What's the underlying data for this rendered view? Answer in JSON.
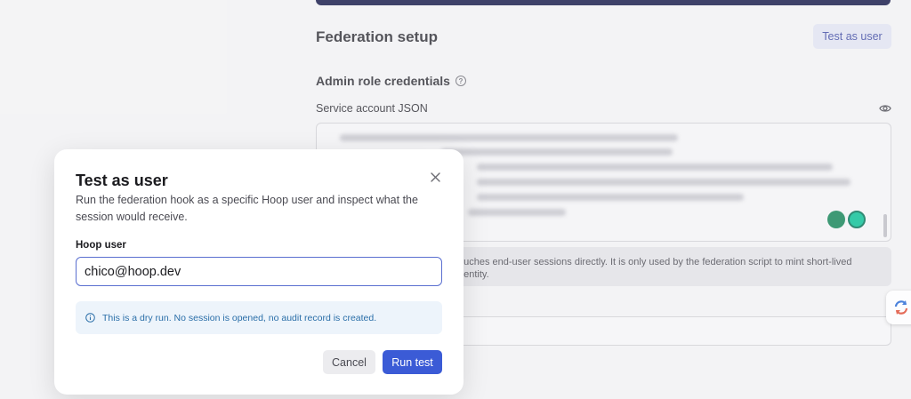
{
  "background": {
    "section_title": "Federation setup",
    "test_as_user_button": "Test as user",
    "admin_title": "Admin role credentials",
    "service_account_label": "Service account JSON",
    "note_text": "ouches end-user sessions directly. It is only used by the federation script to mint short-lived",
    "note_text_2": "dentity."
  },
  "modal": {
    "title": "Test as user",
    "description": "Run the federation hook as a specific Hoop user and inspect what the session would receive.",
    "hoop_user_label": "Hoop user",
    "hoop_user_value": "chico@hoop.dev",
    "info_text": "This is a dry run. No session is opened, no audit record is created.",
    "cancel_label": "Cancel",
    "run_label": "Run test"
  },
  "colors": {
    "accent": "#3b5bd6",
    "info_bg": "#edf4fb",
    "info_text": "#2a6ea8"
  },
  "icons": [
    "help-icon",
    "eye-icon",
    "close-icon",
    "info-icon",
    "grammarly-icon",
    "sync-widget-icon"
  ]
}
